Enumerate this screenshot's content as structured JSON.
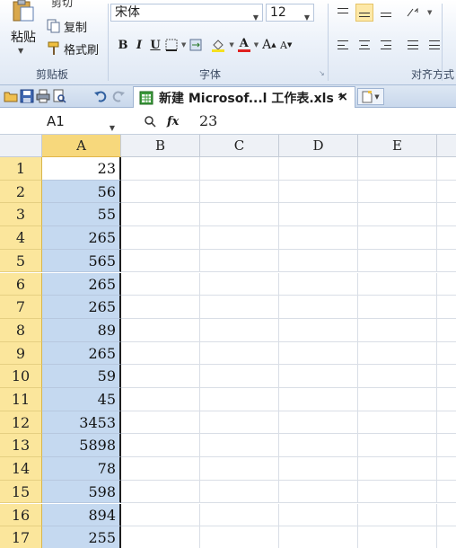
{
  "ribbon": {
    "clipboard": {
      "cut_label": "剪切",
      "paste_label": "粘贴",
      "copy_label": "复制",
      "format_painter_label": "格式刷",
      "group_label": "剪贴板"
    },
    "font": {
      "font_name": "宋体",
      "font_size": "12",
      "bold": "B",
      "italic": "I",
      "underline": "U",
      "font_color_glyph": "A",
      "grow_glyph": "A",
      "shrink_glyph": "A",
      "group_label": "字体"
    },
    "alignment": {
      "group_label": "对齐方式"
    }
  },
  "tabbar": {
    "document_tab": "新建 Microsof...l 工作表.xls *",
    "close_glyph": "×"
  },
  "formula_bar": {
    "name_box": "A1",
    "fx_label": "fx",
    "value": "23"
  },
  "grid": {
    "columns": [
      "A",
      "B",
      "C",
      "D",
      "E"
    ],
    "rows": [
      {
        "num": "1",
        "a": "23"
      },
      {
        "num": "2",
        "a": "56"
      },
      {
        "num": "3",
        "a": "55"
      },
      {
        "num": "4",
        "a": "265"
      },
      {
        "num": "5",
        "a": "565"
      },
      {
        "num": "6",
        "a": "265"
      },
      {
        "num": "7",
        "a": "265"
      },
      {
        "num": "8",
        "a": "89"
      },
      {
        "num": "9",
        "a": "265"
      },
      {
        "num": "10",
        "a": "59"
      },
      {
        "num": "11",
        "a": "45"
      },
      {
        "num": "12",
        "a": "3453"
      },
      {
        "num": "13",
        "a": "5898"
      },
      {
        "num": "14",
        "a": "78"
      },
      {
        "num": "15",
        "a": "598"
      },
      {
        "num": "16",
        "a": "894"
      },
      {
        "num": "17",
        "a": "255"
      }
    ]
  }
}
